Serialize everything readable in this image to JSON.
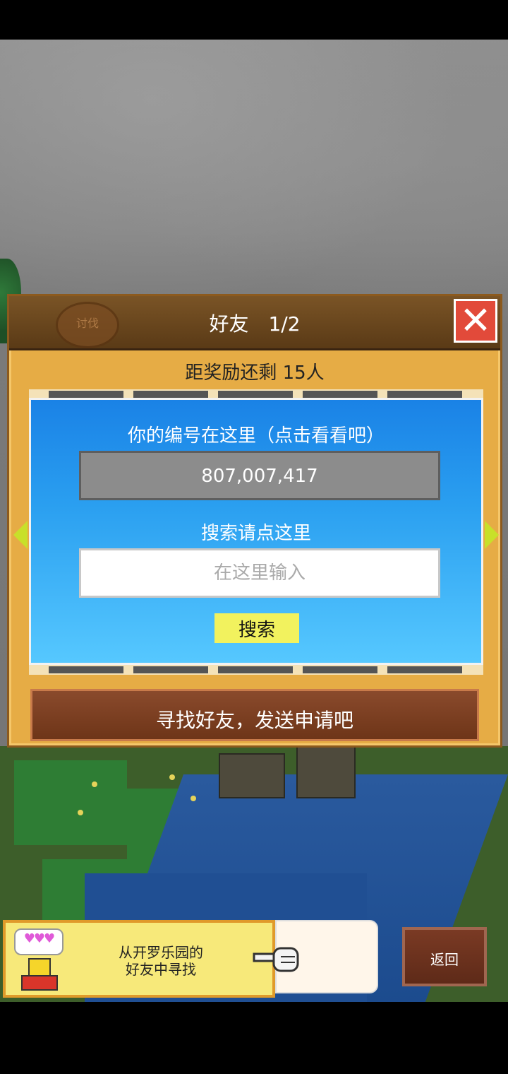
{
  "dialog": {
    "title": "好友　1/2",
    "close_label": "✕",
    "emblem_text": "讨伐",
    "reward_text": "距奖励还剩 15人",
    "id_label": "你的编号在这里（点击看看吧）",
    "id_value": "807,007,417",
    "search_label": "搜索请点这里",
    "search_placeholder": "在这里输入",
    "search_value": "",
    "search_button": "搜索",
    "find_button": "寻找好友，发送申请吧"
  },
  "banner": {
    "text_line1": "从开罗乐园的",
    "text_line2": "好友中寻找",
    "hearts": "♥♥♥"
  },
  "back_button": "返回",
  "colors": {
    "dialog_bg": "#e6ac45",
    "header_bg": "#6a4620",
    "close_red": "#e24a3a",
    "panel_blue": "#2a9ff0",
    "id_box_gray": "#8c8c8c",
    "search_button_yellow": "#f2f25e",
    "find_button_brown": "#7a3e22",
    "arrow_green": "#c8e02a"
  }
}
